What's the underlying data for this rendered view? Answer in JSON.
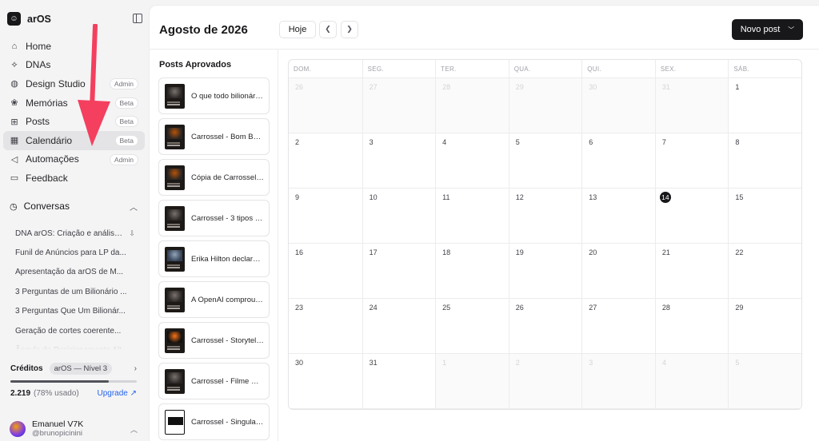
{
  "app": {
    "name": "arOS"
  },
  "sidebar": {
    "items": [
      {
        "label": "Home",
        "icon": "home-icon",
        "badge": ""
      },
      {
        "label": "DNAs",
        "icon": "dna-icon",
        "badge": ""
      },
      {
        "label": "Design Studio",
        "icon": "palette-icon",
        "badge": "Admin"
      },
      {
        "label": "Memórias",
        "icon": "brain-icon",
        "badge": "Beta"
      },
      {
        "label": "Posts",
        "icon": "grid-icon",
        "badge": "Beta"
      },
      {
        "label": "Calendário",
        "icon": "calendar-icon",
        "badge": "Beta",
        "active": true
      },
      {
        "label": "Automações",
        "icon": "megaphone-icon",
        "badge": "Admin"
      },
      {
        "label": "Feedback",
        "icon": "message-icon",
        "badge": ""
      }
    ],
    "conversations_label": "Conversas",
    "conversations": [
      "DNA arOS: Criação e análise ...",
      "Funil de Anúncios para LP da...",
      "Apresentação da arOS de M...",
      "3 Perguntas de um Bilionário ...",
      "3 Perguntas Que Um Bilionár...",
      "Geração de cortes coerente...",
      "Ângulo de Posicionamento Alt..."
    ],
    "credits": {
      "label": "Créditos",
      "plan": "arOS — Nível 3",
      "amount": "2.219",
      "used": "(78% usado)",
      "used_fraction": 0.78,
      "upgrade": "Upgrade ↗"
    },
    "user": {
      "name": "Emanuel V7K",
      "handle": "@brunopicinini"
    }
  },
  "header": {
    "month_title": "Agosto de 2026",
    "today_label": "Hoje",
    "new_post_label": "Novo post"
  },
  "approved": {
    "title": "Posts Aprovados",
    "posts": [
      "O que todo bilionário ...",
      "Carrossel - Bom Boni...",
      "Cópia de Carrossel - ...",
      "Carrossel - 3 tipos de...",
      "Erika Hilton declarou ...",
      "A OpenAI comprou a ...",
      "Carrossel - Storytellin...",
      "Carrossel - Filme Ho...",
      "Carrossel - Singulari..."
    ]
  },
  "calendar": {
    "weekdays": [
      "DOM.",
      "SEG.",
      "TER.",
      "QUA.",
      "QUI.",
      "SEX.",
      "SÁB."
    ],
    "today": "14",
    "days": [
      {
        "d": "26",
        "out": true
      },
      {
        "d": "27",
        "out": true
      },
      {
        "d": "28",
        "out": true
      },
      {
        "d": "29",
        "out": true
      },
      {
        "d": "30",
        "out": true
      },
      {
        "d": "31",
        "out": true
      },
      {
        "d": "1"
      },
      {
        "d": "2"
      },
      {
        "d": "3"
      },
      {
        "d": "4"
      },
      {
        "d": "5"
      },
      {
        "d": "6"
      },
      {
        "d": "7"
      },
      {
        "d": "8"
      },
      {
        "d": "9"
      },
      {
        "d": "10"
      },
      {
        "d": "11"
      },
      {
        "d": "12"
      },
      {
        "d": "13"
      },
      {
        "d": "14"
      },
      {
        "d": "15"
      },
      {
        "d": "16"
      },
      {
        "d": "17"
      },
      {
        "d": "18"
      },
      {
        "d": "19"
      },
      {
        "d": "20"
      },
      {
        "d": "21"
      },
      {
        "d": "22"
      },
      {
        "d": "23"
      },
      {
        "d": "24"
      },
      {
        "d": "25"
      },
      {
        "d": "26"
      },
      {
        "d": "27"
      },
      {
        "d": "28"
      },
      {
        "d": "29"
      },
      {
        "d": "30"
      },
      {
        "d": "31"
      },
      {
        "d": "1",
        "out": true
      },
      {
        "d": "2",
        "out": true
      },
      {
        "d": "3",
        "out": true
      },
      {
        "d": "4",
        "out": true
      },
      {
        "d": "5",
        "out": true
      }
    ]
  },
  "colors": {
    "primary": "#18181b",
    "annotation_arrow": "#f43f5e",
    "link": "#2563eb"
  }
}
